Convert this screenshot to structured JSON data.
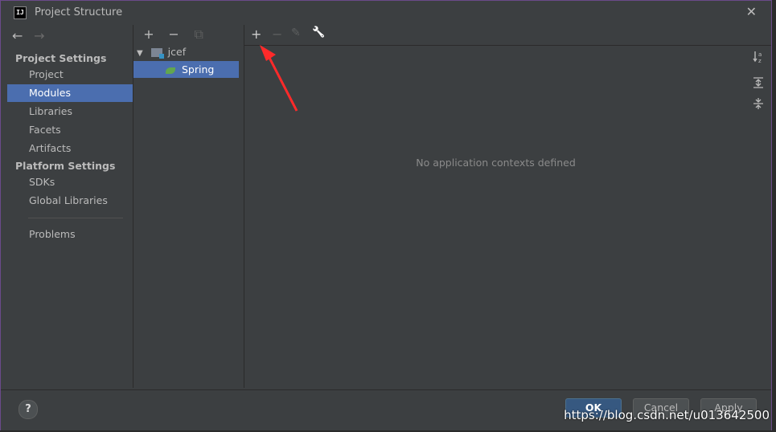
{
  "window": {
    "title": "Project Structure",
    "close_glyph": "✕",
    "app_icon_text": "IJ"
  },
  "nav": {
    "back_glyph": "←",
    "forward_glyph": "→"
  },
  "sidebar": {
    "project_settings_header": "Project Settings",
    "platform_settings_header": "Platform Settings",
    "items": [
      {
        "label": "Project",
        "selected": false
      },
      {
        "label": "Modules",
        "selected": true
      },
      {
        "label": "Libraries",
        "selected": false
      },
      {
        "label": "Facets",
        "selected": false
      },
      {
        "label": "Artifacts",
        "selected": false
      },
      {
        "label": "SDKs",
        "selected": false
      },
      {
        "label": "Global Libraries",
        "selected": false
      },
      {
        "label": "Problems",
        "selected": false
      }
    ]
  },
  "module_tree": {
    "toolbar": {
      "add": "+",
      "remove": "−",
      "copy": "⧉"
    },
    "nodes": [
      {
        "label": "jcef",
        "expanded": true,
        "icon": "module-folder-icon"
      },
      {
        "label": "Spring",
        "selected": true,
        "icon": "spring-leaf-icon"
      }
    ]
  },
  "facet_panel": {
    "toolbar": {
      "add": "+",
      "remove": "−",
      "edit": "✎",
      "settings": "🔧"
    },
    "empty_message": "No application contexts defined",
    "side_icons": [
      "sort-icon",
      "expand-all-icon",
      "collapse-all-icon"
    ]
  },
  "footer": {
    "help": "?",
    "ok": "OK",
    "cancel": "Cancel",
    "apply": "Apply"
  },
  "watermark": "https://blog.csdn.net/u013642500",
  "colors": {
    "selection": "#4b6eaf",
    "background": "#3c3f41",
    "annotation_arrow": "#ff2a2a",
    "primary_button": "#365880"
  }
}
